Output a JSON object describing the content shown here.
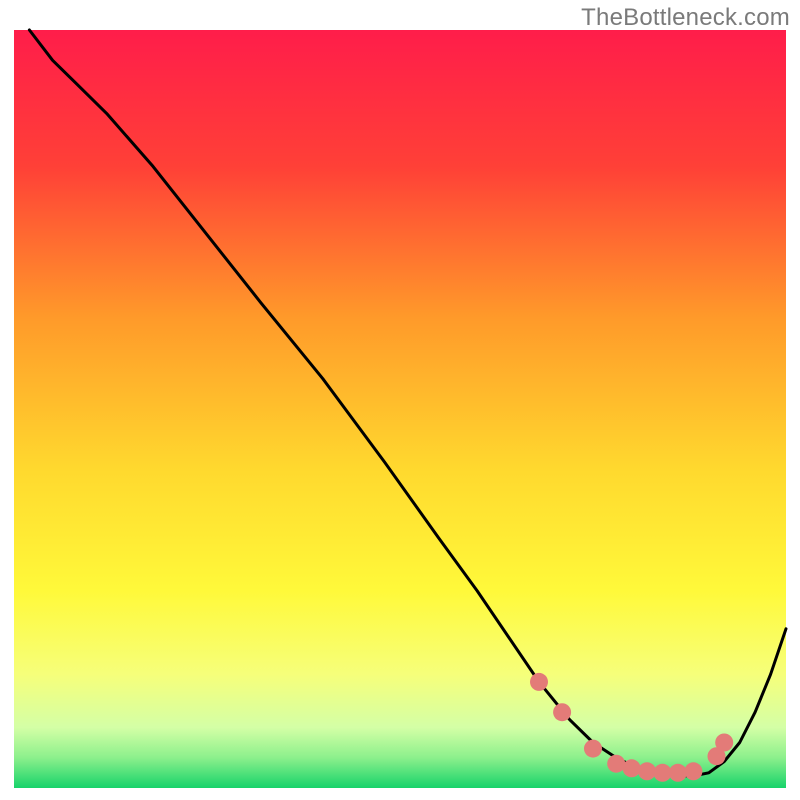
{
  "attribution": "TheBottleneck.com",
  "chart_data": {
    "type": "line",
    "title": "",
    "xlabel": "",
    "ylabel": "",
    "xlim": [
      0,
      100
    ],
    "ylim": [
      0,
      100
    ],
    "grid": false,
    "legend": false,
    "background_gradient": {
      "top": "#ff1d4a",
      "mid_upper": "#ff7a2a",
      "mid": "#ffe63a",
      "mid_lower": "#f7ff6a",
      "band": "#d9ffb0",
      "bottom": "#17d36a"
    },
    "series": [
      {
        "name": "curve",
        "color": "#000000",
        "x": [
          2,
          5,
          8,
          12,
          18,
          25,
          32,
          40,
          48,
          55,
          60,
          64,
          68,
          72,
          75,
          78,
          80,
          82,
          84,
          86,
          88,
          90,
          92,
          94,
          96,
          98,
          100
        ],
        "y": [
          100,
          96,
          93,
          89,
          82,
          73,
          64,
          54,
          43,
          33,
          26,
          20,
          14,
          9,
          6,
          4,
          3,
          2.2,
          1.8,
          1.6,
          1.6,
          2,
          3.5,
          6,
          10,
          15,
          21
        ]
      }
    ],
    "markers": {
      "name": "highlight-dots",
      "color": "#e37b78",
      "radius": 9,
      "x": [
        68,
        71,
        75,
        78,
        80,
        82,
        84,
        86,
        88,
        91,
        92
      ],
      "y": [
        14,
        10,
        5.2,
        3.2,
        2.6,
        2.2,
        2.0,
        2.0,
        2.2,
        4.2,
        6.0
      ]
    }
  }
}
